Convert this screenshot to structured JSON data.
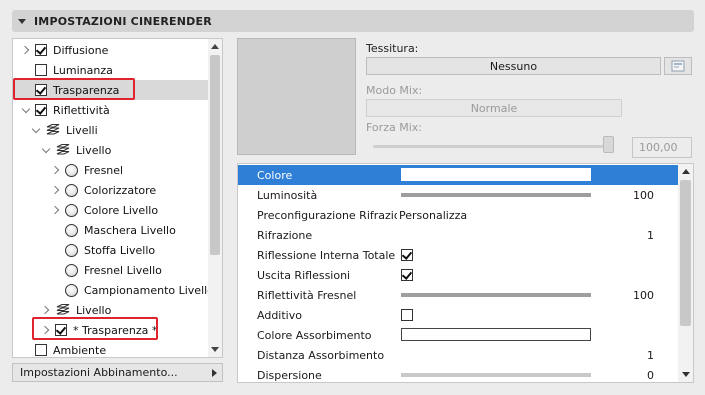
{
  "header": {
    "title": "IMPOSTAZIONI CINERENDER"
  },
  "tree": {
    "items": [
      {
        "label": "Diffusione",
        "chevron": "right",
        "control": "checkbox",
        "checked": true
      },
      {
        "label": "Luminanza",
        "chevron": "none",
        "control": "checkbox",
        "checked": false
      },
      {
        "label": "Trasparenza",
        "chevron": "none",
        "control": "checkbox",
        "checked": true,
        "selected": true,
        "highlighted": true
      },
      {
        "label": "Riflettività",
        "chevron": "down",
        "control": "checkbox",
        "checked": true
      },
      {
        "label": "Livelli",
        "chevron": "down",
        "control": "layers-icon"
      },
      {
        "label": "Livello",
        "chevron": "down",
        "control": "layers-icon"
      },
      {
        "label": "Fresnel",
        "chevron": "right",
        "control": "sphere-icon"
      },
      {
        "label": "Colorizzatore",
        "chevron": "right",
        "control": "sphere-icon"
      },
      {
        "label": "Colore Livello",
        "chevron": "right",
        "control": "sphere-icon"
      },
      {
        "label": "Maschera Livello",
        "chevron": "none",
        "control": "sphere-icon"
      },
      {
        "label": "Stoffa Livello",
        "chevron": "none",
        "control": "sphere-icon"
      },
      {
        "label": "Fresnel Livello",
        "chevron": "none",
        "control": "sphere-icon"
      },
      {
        "label": "Campionamento Livello",
        "chevron": "none",
        "control": "sphere-icon"
      },
      {
        "label": "Livello",
        "chevron": "right",
        "control": "layers-icon"
      },
      {
        "label": "* Trasparenza *",
        "chevron": "right",
        "control": "checkbox",
        "checked": true,
        "highlighted": true
      },
      {
        "label": "Ambiente",
        "chevron": "none",
        "control": "checkbox",
        "checked": false
      }
    ]
  },
  "bottom_button": {
    "label": "Impostazioni Abbinamento..."
  },
  "texture": {
    "label": "Tessitura:",
    "value": "Nessuno",
    "mix_mode_label": "Modo Mix:",
    "mix_mode_value": "Normale",
    "mix_strength_label": "Forza Mix:",
    "mix_strength_value": "100,00",
    "mix_strength_level": 1.0
  },
  "properties": [
    {
      "name": "Colore",
      "type": "color",
      "selected": true
    },
    {
      "name": "Luminosità",
      "type": "slider",
      "level": 1.0,
      "value": "100"
    },
    {
      "name": "Preconfigurazione Rifrazione",
      "type": "text",
      "value": "Personalizza"
    },
    {
      "name": "Rifrazione",
      "type": "number",
      "value": "1"
    },
    {
      "name": "Riflessione Interna Totale",
      "type": "checkbox",
      "checked": true
    },
    {
      "name": "Uscita Riflessioni",
      "type": "checkbox",
      "checked": true
    },
    {
      "name": "Riflettività Fresnel",
      "type": "slider",
      "level": 1.0,
      "value": "100"
    },
    {
      "name": "Additivo",
      "type": "checkbox",
      "checked": false
    },
    {
      "name": "Colore Assorbimento",
      "type": "color"
    },
    {
      "name": "Distanza Assorbimento",
      "type": "number",
      "value": "1"
    },
    {
      "name": "Dispersione",
      "type": "slider",
      "level": 0.0,
      "value": "0"
    }
  ],
  "colors": {
    "selection_blue": "#2f7fd6",
    "highlight_red": "#e0232d"
  }
}
